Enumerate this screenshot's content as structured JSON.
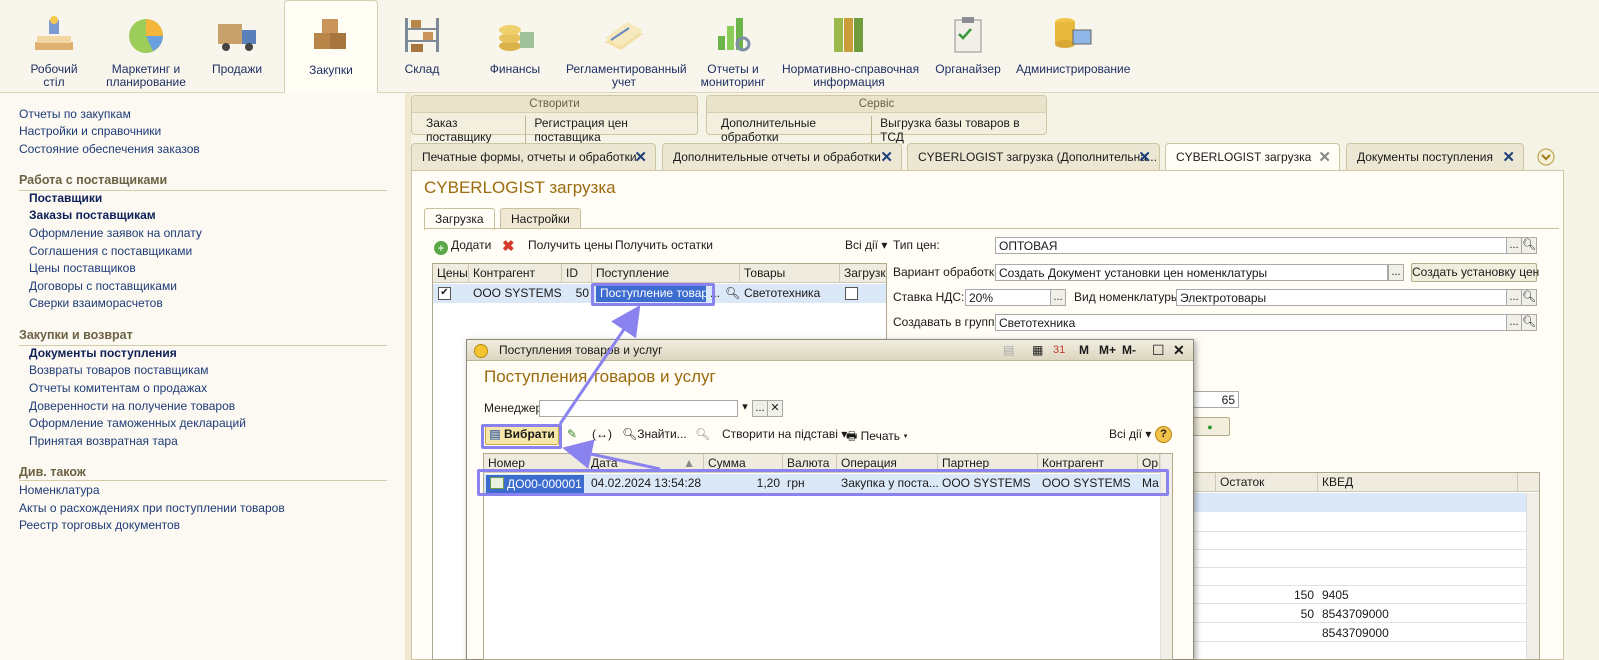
{
  "sections": [
    {
      "label": "Робочий\nстіл",
      "icon": "desk-icon",
      "active": false
    },
    {
      "label": "Маркетинг и\nпланирование",
      "icon": "pie-chart-icon",
      "active": false
    },
    {
      "label": "Продажи",
      "icon": "truck-icon",
      "active": false
    },
    {
      "label": "Закупки",
      "icon": "boxes-icon",
      "active": true
    },
    {
      "label": "Склад",
      "icon": "warehouse-rack-icon",
      "active": false
    },
    {
      "label": "Финансы",
      "icon": "coins-icon",
      "active": false
    },
    {
      "label": "Регламентированный\nучет",
      "icon": "documents-icon",
      "active": false
    },
    {
      "label": "Отчеты и\nмониторинг",
      "icon": "bar-chart-magnifier-icon",
      "active": false
    },
    {
      "label": "Нормативно-справочная\nинформация",
      "icon": "binders-icon",
      "active": false
    },
    {
      "label": "Органайзер",
      "icon": "clipboard-icon",
      "active": false
    },
    {
      "label": "Администрирование",
      "icon": "database-computer-icon",
      "active": false
    }
  ],
  "nav": {
    "top_links": [
      "Отчеты по закупкам",
      "Настройки и справочники",
      "Состояние обеспечения заказов"
    ],
    "group1": {
      "title": "Работа с поставщиками",
      "items": [
        "Поставщики",
        "Заказы поставщикам",
        "Оформление заявок на оплату",
        "Соглашения с поставщиками",
        "Цены поставщиков",
        "Договоры с поставщиками",
        "Сверки взаиморасчетов"
      ]
    },
    "group2": {
      "title": "Закупки и возврат",
      "items": [
        "Документы поступления",
        "Возвраты товаров поставщикам",
        "Отчеты комитентам о продажах",
        "Доверенности на получение товаров",
        "Оформление таможенных деклараций",
        "Принятая возвратная тара"
      ]
    },
    "group3": {
      "title": "Див. також",
      "items": [
        "Номенклатура",
        "Акты о расхождениях при поступлении товаров",
        "Реестр торговых документов"
      ]
    }
  },
  "commands": {
    "create": {
      "title": "Створити",
      "items": [
        "Заказ поставщику",
        "Регистрация цен поставщика"
      ]
    },
    "service": {
      "title": "Сервіс",
      "items": [
        "Дополнительные обработки",
        "Выгрузка базы товаров в ТСД"
      ]
    }
  },
  "doc_tabs": [
    "Печатные формы, отчеты и обработки",
    "Дополнительные отчеты и обработки",
    "CYBERLOGIST загрузка (Дополнительна...",
    "CYBERLOGIST загрузка",
    "Документы поступления"
  ],
  "form": {
    "title": "CYBERLOGIST загрузка",
    "tabs": [
      "Загрузка",
      "Настройки"
    ],
    "toolbar": {
      "add": "Додати",
      "get_prices": "Получить цены",
      "get_stock": "Получить остатки",
      "all_actions": "Всі дії"
    },
    "grid_headers": [
      "Цены",
      "Контрагент",
      "ID",
      "Поступление",
      "Товары",
      "Загрузка"
    ],
    "grid_row": {
      "counterparty": "ООО SYSTEMS",
      "id": "50",
      "receipt": "Поступление товаров",
      "goods": "Светотехника"
    },
    "price_type_label": "Тип цен:",
    "price_type": "ОПТОВАЯ",
    "processing_label": "Вариант обработки:",
    "processing": "Создать Документ установки цен номенклатуры",
    "create_btn": "Создать установку цен",
    "vat_label": "Ставка НДС:",
    "vat": "20%",
    "nom_type_label": "Вид номенклатуры:",
    "nom_type": "Электротовары",
    "group_label": "Создавать в группе:",
    "group": "Светотехника",
    "hidden_value": "65",
    "right_headers": [
      "Остаток",
      "КВЕД"
    ],
    "right_rows": [
      {
        "stock": "150",
        "kved": "9405"
      },
      {
        "stock": "50",
        "kved": "8543709000"
      },
      {
        "stock": "",
        "kved": "8543709000"
      }
    ]
  },
  "popup": {
    "window_title": "Поступления товаров и услуг",
    "title": "Поступления товаров и услуг",
    "manager_label": "Менеджер:",
    "toolbar": {
      "select": "Вибрати",
      "find": "Знайти...",
      "create_based": "Створити на підставі",
      "print": "Печать",
      "all_actions": "Всі дії"
    },
    "title_buttons": [
      "M",
      "M+",
      "M-"
    ],
    "headers": [
      "Номер",
      "Дата",
      "Сумма",
      "Валюта",
      "Операция",
      "Партнер",
      "Контрагент",
      "Ор"
    ],
    "row": {
      "number": "ДО00-000001",
      "date": "04.02.2024 13:54:28",
      "sum": "1,20",
      "currency": "грн",
      "operation": "Закупка у поста...",
      "partner": "ООО SYSTEMS",
      "counterparty": "ООО SYSTEMS",
      "org": "Ма"
    }
  },
  "colors": {
    "accent": "#9b6b0e",
    "highlight": "#8a83ef",
    "selected_row": "#dbe8f8"
  }
}
